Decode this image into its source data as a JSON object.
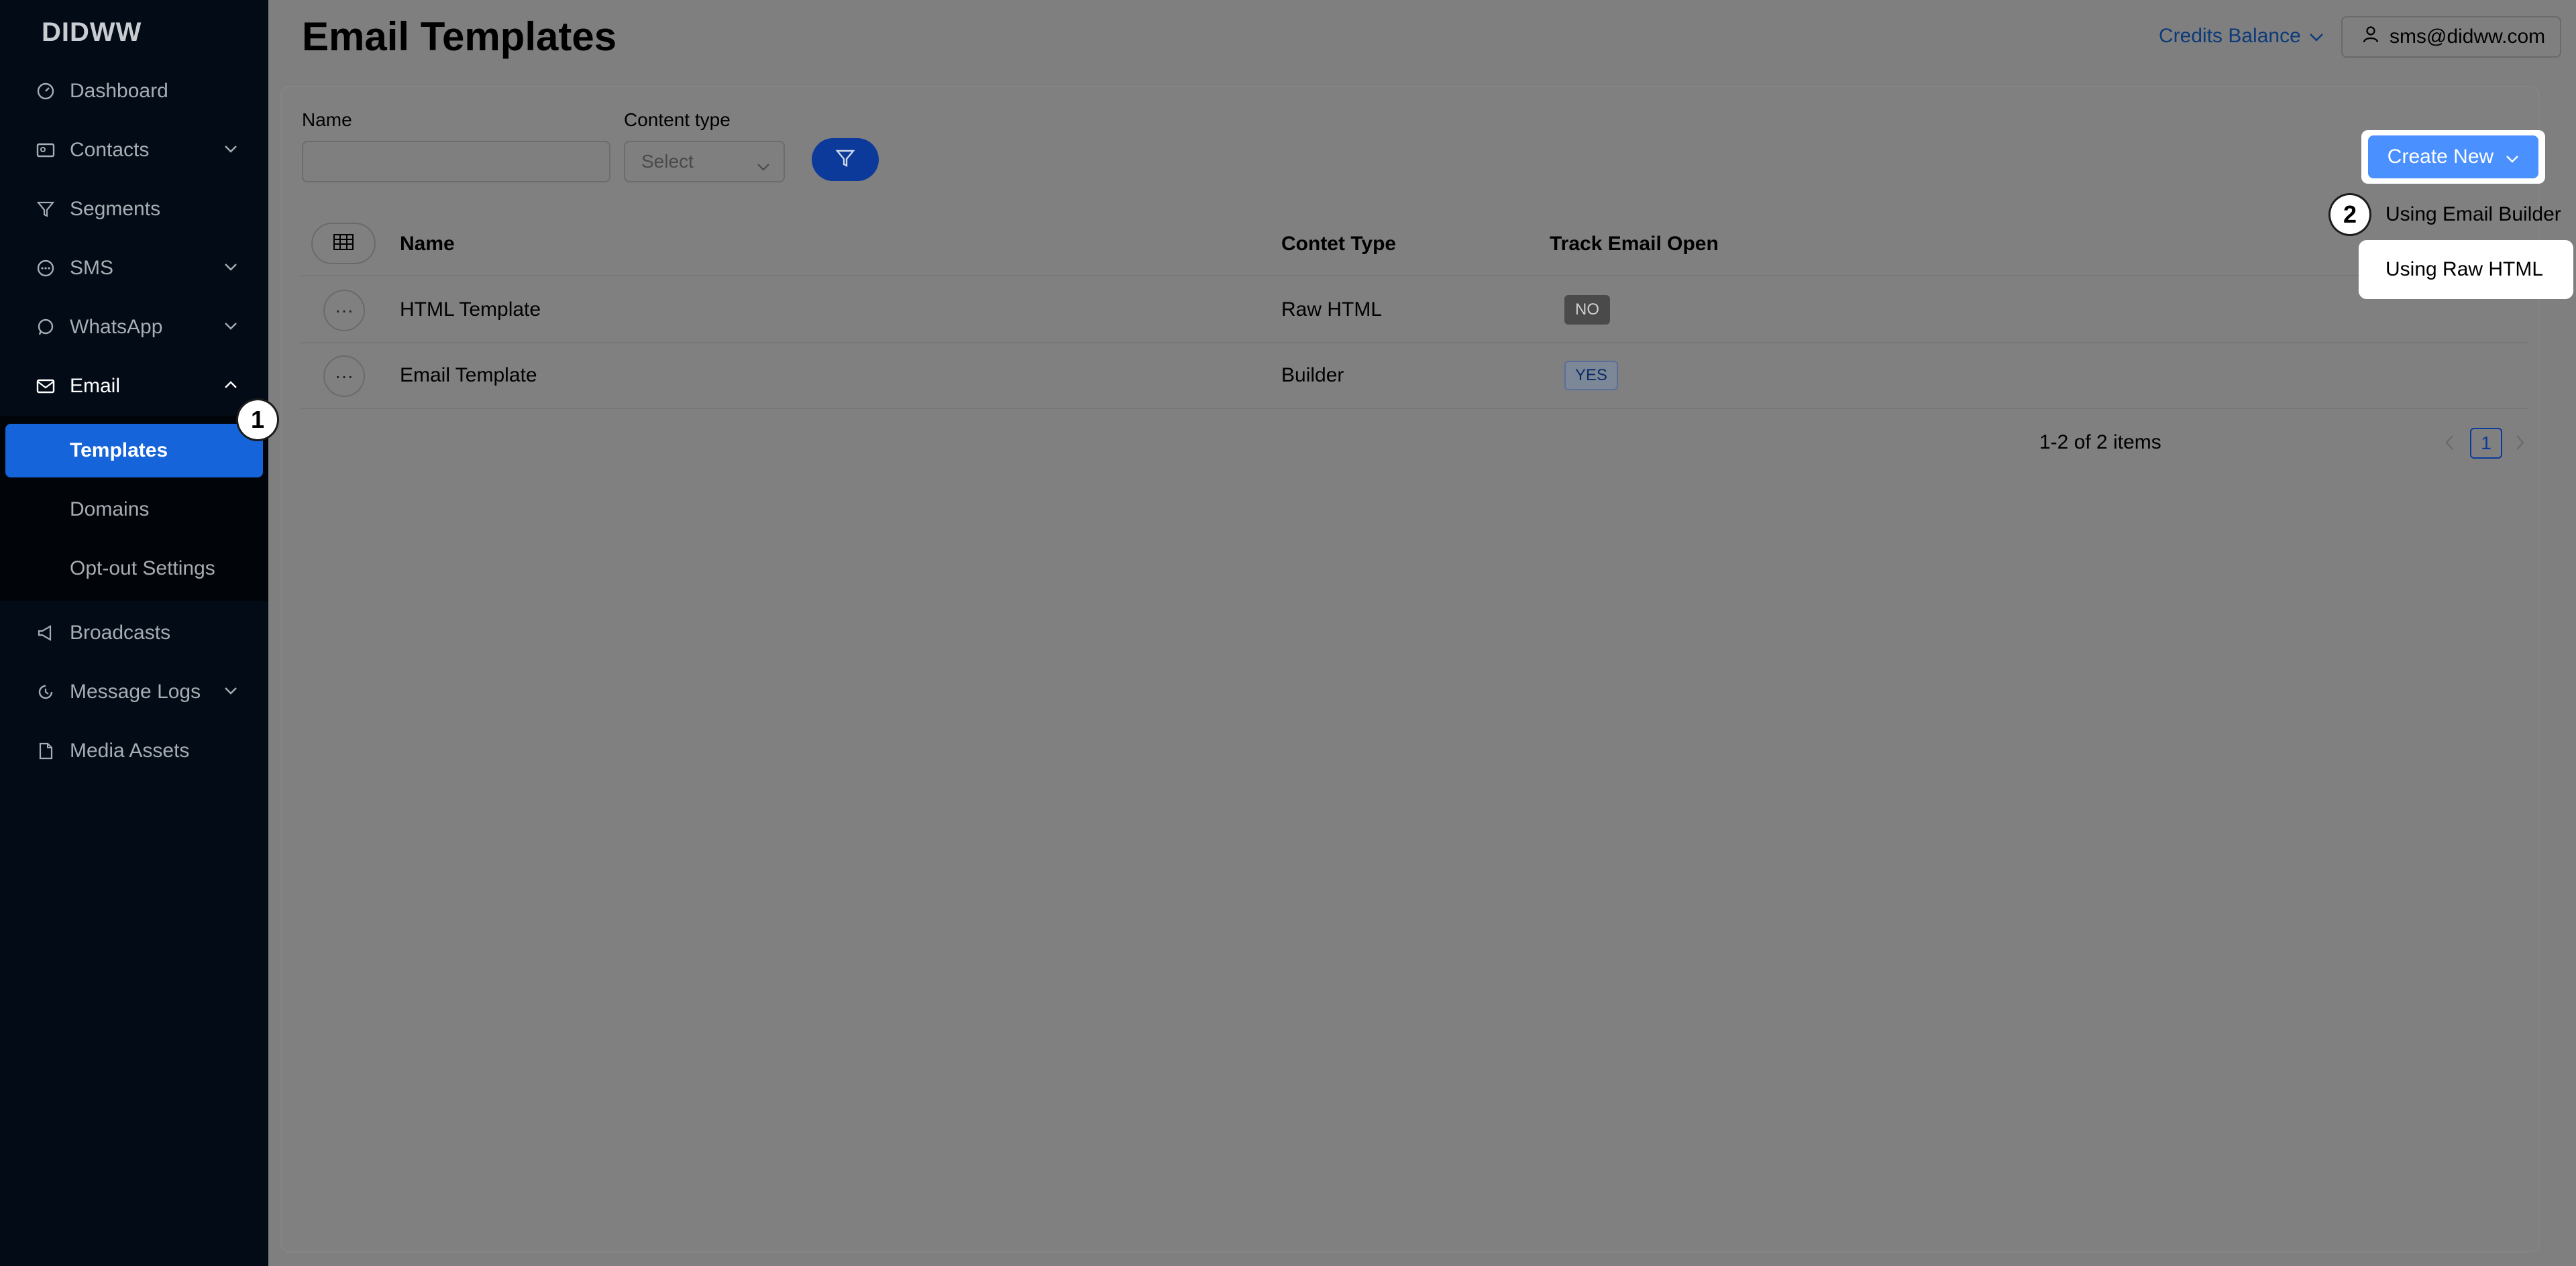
{
  "brand": {
    "logo": "DIDWW"
  },
  "sidebar": {
    "items": [
      {
        "label": "Dashboard",
        "icon": "dashboard-icon",
        "chevron": false
      },
      {
        "label": "Contacts",
        "icon": "contacts-icon",
        "chevron": true
      },
      {
        "label": "Segments",
        "icon": "filter-icon",
        "chevron": false
      },
      {
        "label": "SMS",
        "icon": "sms-icon",
        "chevron": true
      },
      {
        "label": "WhatsApp",
        "icon": "whatsapp-icon",
        "chevron": true
      },
      {
        "label": "Email",
        "icon": "mail-icon",
        "chevron": true,
        "expanded": true
      },
      {
        "label": "Broadcasts",
        "icon": "broadcast-icon",
        "chevron": false
      },
      {
        "label": "Message Logs",
        "icon": "history-icon",
        "chevron": true
      },
      {
        "label": "Media Assets",
        "icon": "file-icon",
        "chevron": false
      }
    ],
    "email_sub": [
      {
        "label": "Templates",
        "active": true
      },
      {
        "label": "Domains",
        "active": false
      },
      {
        "label": "Opt-out Settings",
        "active": false
      }
    ]
  },
  "steps": {
    "one": "1",
    "two": "2"
  },
  "header": {
    "title": "Email Templates",
    "credits_label": "Credits Balance",
    "user_email": "sms@didww.com"
  },
  "filters": {
    "name_label": "Name",
    "name_value": "",
    "content_type_label": "Content type",
    "content_type_placeholder": "Select"
  },
  "create": {
    "button_label": "Create New",
    "options": [
      "Using Email Builder",
      "Using Raw HTML"
    ]
  },
  "table": {
    "columns": [
      "Name",
      "Contet Type",
      "Track Email Open"
    ],
    "rows": [
      {
        "name": "HTML Template",
        "content_type": "Raw HTML",
        "track": "NO"
      },
      {
        "name": "Email Template",
        "content_type": "Builder",
        "track": "YES"
      }
    ]
  },
  "pagination": {
    "summary": "1-2 of 2 items",
    "current_page": "1"
  },
  "colors": {
    "sidebar_bg": "#020b16",
    "active_item": "#1664d9",
    "primary_button": "#4a90ff",
    "overlay_gray": "#7f7f7f"
  }
}
